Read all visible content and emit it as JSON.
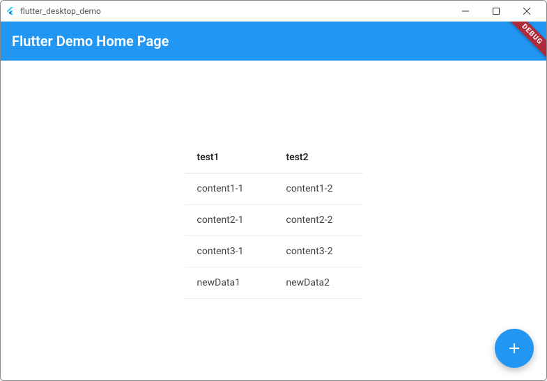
{
  "window": {
    "title": "flutter_desktop_demo"
  },
  "appbar": {
    "title": "Flutter Demo Home Page"
  },
  "debug_label": "DEBUG",
  "table": {
    "headers": [
      "test1",
      "test2"
    ],
    "rows": [
      [
        "content1-1",
        "content1-2"
      ],
      [
        "content2-1",
        "content2-2"
      ],
      [
        "content3-1",
        "content3-2"
      ],
      [
        "newData1",
        "newData2"
      ]
    ]
  },
  "fab": {
    "label": "+"
  },
  "colors": {
    "primary": "#2196f3",
    "ribbon": "#b02b3a"
  }
}
